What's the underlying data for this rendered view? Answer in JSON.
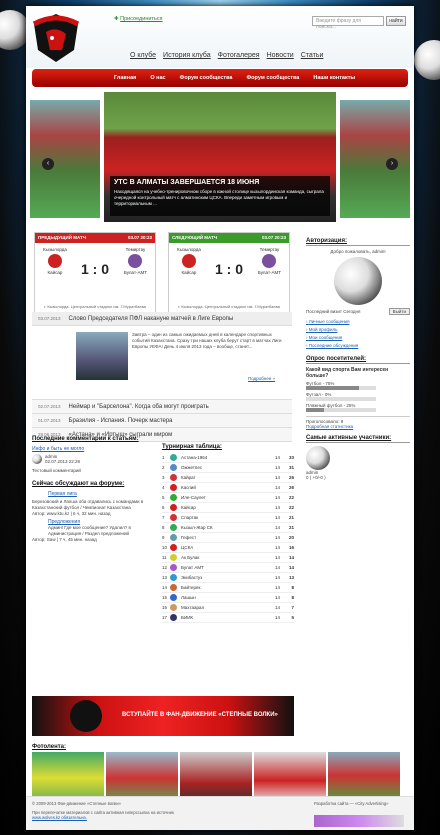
{
  "header": {
    "logo_text": "СТЕПНЫЕ ВОЛКИ",
    "join_label": "Присоединиться",
    "search_placeholder": "Введите фразу для поиска...",
    "search_button": "найти"
  },
  "top_nav": [
    "О клубе",
    "История клуба",
    "Фотогалерея",
    "Новости",
    "Статьи"
  ],
  "main_nav": [
    "Главная",
    "О нас",
    "Форум сообщества",
    "Форум сообщества",
    "Наши контакты"
  ],
  "slider": {
    "title": "УТС В АЛМАТЫ ЗАВЕРШАЕТСЯ 18 ИЮНЯ",
    "text": "Находящаяся на учебно-тренировочном сборе в южной столице кызылординская команда, сыграла очередной контрольный матч с алматинским ЦСКА. Впереди заметным игровым и территориальным ..."
  },
  "prev_match": {
    "label": "ПРЕДЫДУЩИЙ МАТЧ",
    "date": "03.07 20:23",
    "home_city": "Кызылорда",
    "home": "Кайсар",
    "away_city": "Темиртау",
    "away": "Булат-АМТ",
    "score": "1 : 0",
    "venue": "г. Кызылорда. Центральный стадион им. Г.Муратбаева"
  },
  "next_match": {
    "label": "СЛЕДУЮЩИЙ МАТЧ",
    "date": "03.07 20:23",
    "home_city": "Кызылорда",
    "home": "Кайсар",
    "away_city": "Темиртау",
    "away": "Булат-АМТ",
    "score": "1 : 0",
    "venue": "г. Кызылорда. Центральный стадион им. Г.Муратбаева"
  },
  "auth": {
    "title": "Авторизация:",
    "welcome": "Добро пожаловать, admin!",
    "last_visit": "Последний визит Сегодня",
    "exit": "Выйти",
    "links": [
      "Личные сообщения",
      "Мой профиль",
      "Мои сообщения",
      "Последние обсуждения"
    ]
  },
  "poll": {
    "title": "Опрос посетителей:",
    "question": "Какой вид спорта Вам интересен больше?",
    "options": [
      {
        "label": "Футбол - 75%",
        "value": 75
      },
      {
        "label": "Футзал - 0%",
        "value": 0
      },
      {
        "label": "Пляжный футбол - 25%",
        "value": 25
      }
    ],
    "voted": "Проголосовало: 8",
    "stats": "Подробная статистика"
  },
  "active": {
    "title": "Самые активные участники:",
    "name": "admin",
    "karma": "0 ( +0/-0 )"
  },
  "news": {
    "featured_date": "03.07.2013",
    "featured_title": "Слово Председателя ПФЛ накануне матчей в Лиге Европы",
    "featured_text": "Завтра – один из самых ожидаемых дней в календаре спортивных событий Казахстана. Сразу три наших клуба берут старт в матчах Лиги Европы УЕФА! День 4 июля 2013 года – вообще, станет...",
    "more": "Подробнее »",
    "items": [
      {
        "date": "02.07.2013",
        "title": "Неймар и \"Барселона\". Когда оба могут проиграть"
      },
      {
        "date": "01.07.2013",
        "title": "Бразилия - Испания. Почерк мастера"
      },
      {
        "date": "28.06.2013",
        "title": "«Астана» и «Иртыш» сыграли миром"
      }
    ]
  },
  "comments": {
    "title": "Последние комментарии к статьям:",
    "article": "Инфо и быть не могло",
    "user": "admin",
    "date": "02.07.2013 22:28",
    "text": "Тестовый комментарий"
  },
  "forum": {
    "title": "Сейчас обсуждают на форуме:",
    "t1": "Первая лига",
    "t1_text": "Березовский и Лапша оба отдавались с командами в Казахстанский футбол / Чемпионат Казахстана",
    "t1_meta": "Автор: www.ktu.kz | 6 ч, 32 мин. назад",
    "t2": "Предложения",
    "t2_text": "Админ! Где мое сообщение? Удалил? в Администрация / Раздел предложений",
    "t2_meta": "Автор: Saw | 7 ч, 45 мин. назад"
  },
  "table": {
    "title": "Турнирная таблица:",
    "rows": [
      [
        "1",
        "Астана-1964",
        "14",
        "33"
      ],
      [
        "2",
        "Ожжетпес",
        "14",
        "31"
      ],
      [
        "3",
        "Кайрат",
        "14",
        "26"
      ],
      [
        "4",
        "Каспий",
        "14",
        "26"
      ],
      [
        "5",
        "Иле-Саулет",
        "14",
        "22"
      ],
      [
        "6",
        "Кайсар",
        "14",
        "22"
      ],
      [
        "7",
        "Спартак",
        "14",
        "21"
      ],
      [
        "8",
        "Кызыл-Жар СК",
        "14",
        "21"
      ],
      [
        "9",
        "Гефест",
        "14",
        "20"
      ],
      [
        "10",
        "ЦСКА",
        "14",
        "16"
      ],
      [
        "11",
        "Ак Булак",
        "14",
        "14"
      ],
      [
        "12",
        "Булат АМТ",
        "14",
        "14"
      ],
      [
        "13",
        "Экибастуз",
        "14",
        "13"
      ],
      [
        "14",
        "Байтерек",
        "14",
        "8"
      ],
      [
        "15",
        "Лашын",
        "14",
        "8"
      ],
      [
        "16",
        "Махтаарал",
        "14",
        "7"
      ],
      [
        "17",
        "БИИК",
        "14",
        "5"
      ]
    ]
  },
  "banner": {
    "text": "ВСТУПАЙТЕ В ФАН-ДВИЖЕНИЕ «СТЕПНЫЕ ВОЛКИ»"
  },
  "photos": {
    "title": "Фотолента:"
  },
  "footer": {
    "copyright": "© 2009-2013 Фан-движение «Степные волки»",
    "rule": "При перепечатке материалов с сайта активная гиперссылка на источник",
    "site": "www.wolves.kz обязательна.",
    "dev": "Разработка сайта — «City Advertising»"
  }
}
